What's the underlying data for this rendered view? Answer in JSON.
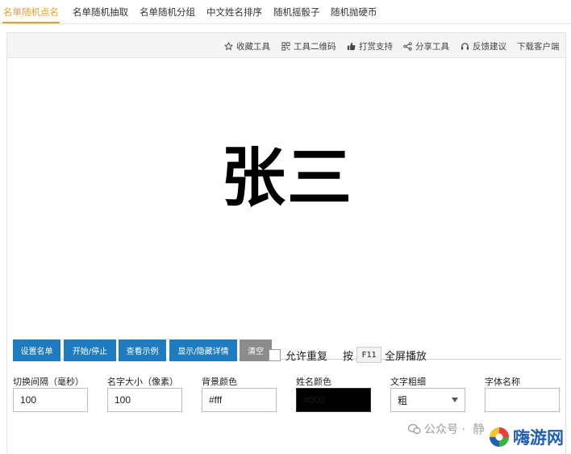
{
  "tabs": [
    {
      "label": "名单随机点名",
      "active": true
    },
    {
      "label": "名单随机抽取"
    },
    {
      "label": "名单随机分组"
    },
    {
      "label": "中文姓名排序"
    },
    {
      "label": "随机摇骰子"
    },
    {
      "label": "随机抛硬币"
    }
  ],
  "toolbar": {
    "favorite": "收藏工具",
    "qrcode": "工具二维码",
    "tip": "打赏支持",
    "share": "分享工具",
    "feedback": "反馈建议",
    "download": "下载客户端"
  },
  "display": {
    "name": "张三"
  },
  "buttons": {
    "set_names": "设置名单",
    "start_stop": "开始/停止",
    "example": "查看示例",
    "toggle_detail": "显示/隐藏详情",
    "clear": "清空"
  },
  "options": {
    "allow_repeat": "允许重复",
    "allow_repeat_checked": false,
    "press": "按",
    "key": "F11",
    "fullscreen": "全屏播放"
  },
  "fields": {
    "interval_label": "切换间隔（毫秒）",
    "interval_value": "100",
    "size_label": "名字大小（像素）",
    "size_value": "100",
    "bg_label": "背景颜色",
    "bg_value": "#fff",
    "name_color_label": "姓名颜色",
    "name_color_value": "#000",
    "weight_label": "文字粗细",
    "weight_value": "粗",
    "font_label": "字体名称"
  },
  "watermark": {
    "wechat": "公众号 ·",
    "wechat_name": "静",
    "logo": "嗨游网"
  },
  "colors": {
    "accent": "#e8a317",
    "button": "#1e7bbf",
    "button_gray": "#8c8c8c",
    "logo": "#1f5fb8"
  }
}
